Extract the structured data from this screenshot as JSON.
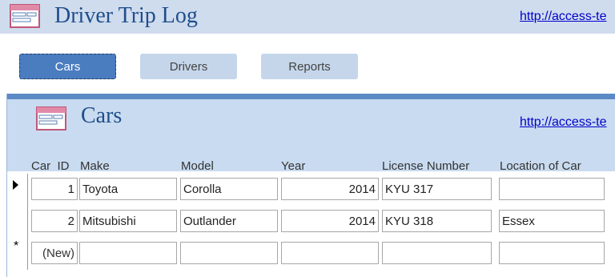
{
  "app": {
    "title": "Driver Trip Log",
    "header_link": "http://access-te",
    "icon": "form-icon"
  },
  "tabs": [
    {
      "label": "Cars",
      "active": true
    },
    {
      "label": "Drivers",
      "active": false
    },
    {
      "label": "Reports",
      "active": false
    }
  ],
  "form": {
    "title": "Cars",
    "link": "http://access-te",
    "icon": "form-icon",
    "columns": [
      "Car_ID",
      "Make",
      "Model",
      "Year",
      "License Number",
      "Location of Car"
    ],
    "rows": [
      {
        "Car_ID": "1",
        "Make": "Toyota",
        "Model": "Corolla",
        "Year": "2014",
        "License Number": "KYU 317",
        "Location of Car": "",
        "current": true
      },
      {
        "Car_ID": "2",
        "Make": "Mitsubishi",
        "Model": "Outlander",
        "Year": "2014",
        "License Number": "KYU 318",
        "Location of Car": "Essex",
        "current": false
      }
    ],
    "new_row": {
      "Car_ID": "(New)",
      "marker": "*"
    }
  },
  "colors": {
    "header_bg": "#cfdcee",
    "form_header_bg": "#c9dbf0",
    "active_tab": "#4a7cc0",
    "tab": "#c5d6ea",
    "title": "#1f4e8c"
  }
}
